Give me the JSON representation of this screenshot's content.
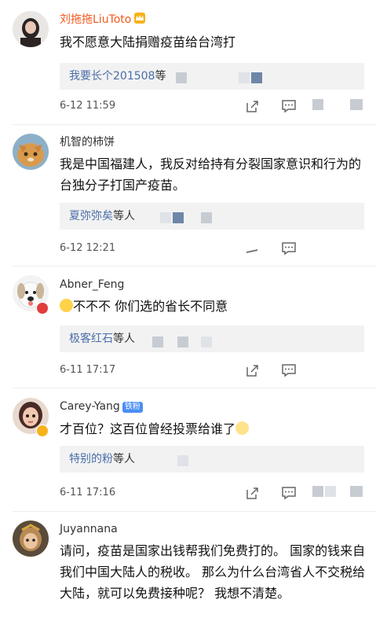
{
  "comments": [
    {
      "name": "刘拖拖LiuToto",
      "text": "我不愿意大陆捐赠疫苗给台湾打",
      "replies_who": "我要长个201508",
      "replies_suffix": "等",
      "time": "6-12 11:59"
    },
    {
      "name": "机智的柿饼",
      "text": "我是中国福建人，我反对给持有分裂国家意识和行为的台独分子打国产疫苗。",
      "replies_who": "夏弥弥矣",
      "replies_suffix": "等人",
      "time": "6-12 12:21"
    },
    {
      "name": "Abner_Feng",
      "text": "不不不     你们选的省长不同意",
      "replies_who": "极客红石",
      "replies_suffix": "等人",
      "time": "6-11 17:17"
    },
    {
      "name": "Carey-Yang",
      "badge": "铁粉",
      "text": "才百位？这百位曾经投票给谁了",
      "replies_who": "特别的粉",
      "replies_suffix": "等人",
      "time": "6-11 17:16"
    },
    {
      "name": "Juyannana",
      "text": "请问，疫苗是国家出钱帮我们免费打的。 国家的钱来自我们中国大陆人的税收。 那么为什么台湾省人不交税给大陆，就可以免费接种呢？ 我想不清楚。"
    }
  ],
  "colors": {
    "vip_name": "#f25a1f",
    "reply_link": "#4a6ea8",
    "reply_bg": "#f2f2f2",
    "fan_badge": "#4b8ef5"
  },
  "icons": [
    "share-icon",
    "comment-icon",
    "crown-icon",
    "emoji-icon"
  ]
}
